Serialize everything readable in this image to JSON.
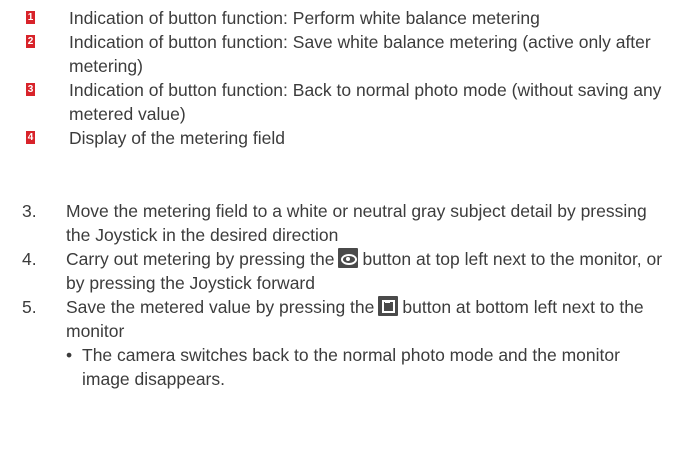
{
  "legend": {
    "marker_color": "#d8232a",
    "items": [
      {
        "number": "1",
        "text": "Indication of button function: Perform white balance metering"
      },
      {
        "number": "2",
        "text": "Indication of button function: Save white balance metering (active only after metering)"
      },
      {
        "number": "3",
        "text": "Indication of button function: Back to normal photo mode (without saving any metered value)"
      },
      {
        "number": "4",
        "text": "Display of the metering field"
      }
    ]
  },
  "steps": [
    {
      "number": "3.",
      "text": "Move the metering field to a white or neutral gray subject detail by pressing the Joystick in the desired direction"
    },
    {
      "number": "4.",
      "text_before": "Carry out metering  by pressing the",
      "icon": "eye-icon",
      "text_after": "button at top left next to the monitor, or by pressing the Joystick forward"
    },
    {
      "number": "5.",
      "text_before": "Save the metered value by pressing the",
      "icon": "save-icon",
      "text_after": "button at bottom left next to the monitor",
      "bullet": {
        "symbol": "•",
        "text": "The camera switches back to the normal photo mode and the monitor image disappears."
      }
    }
  ]
}
